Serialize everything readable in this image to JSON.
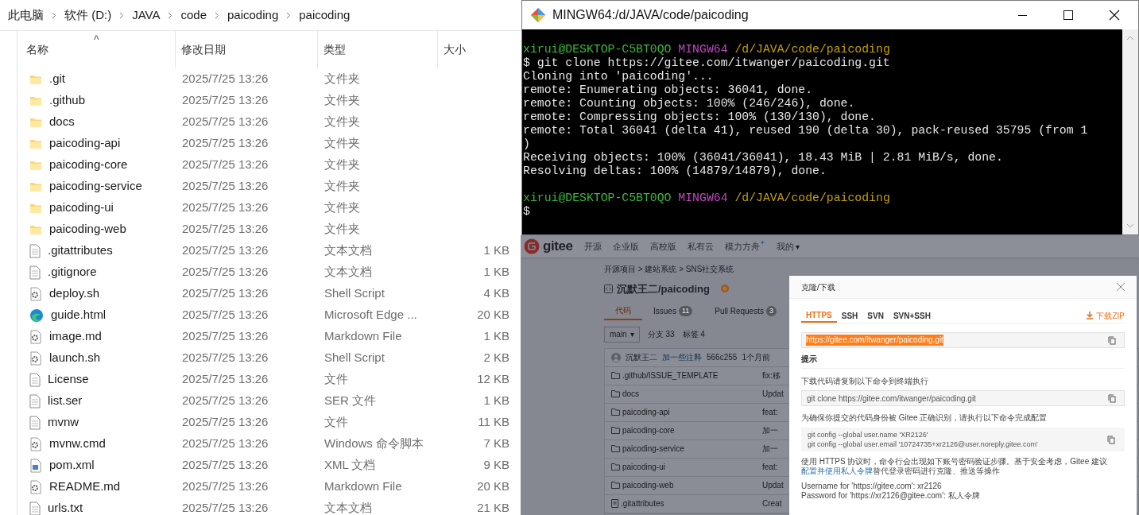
{
  "explorer": {
    "breadcrumb": [
      "此电脑",
      "软件 (D:)",
      "JAVA",
      "code",
      "paicoding",
      "paicoding"
    ],
    "sort_indicator": "^",
    "columns": [
      "名称",
      "修改日期",
      "类型",
      "大小"
    ],
    "rows": [
      {
        "name": ".git",
        "date": "2025/7/25 13:26",
        "type": "文件夹",
        "kind": "folder"
      },
      {
        "name": ".github",
        "date": "2025/7/25 13:26",
        "type": "文件夹",
        "kind": "folder"
      },
      {
        "name": "docs",
        "date": "2025/7/25 13:26",
        "type": "文件夹",
        "kind": "folder"
      },
      {
        "name": "paicoding-api",
        "date": "2025/7/25 13:26",
        "type": "文件夹",
        "kind": "folder"
      },
      {
        "name": "paicoding-core",
        "date": "2025/7/25 13:26",
        "type": "文件夹",
        "kind": "folder"
      },
      {
        "name": "paicoding-service",
        "date": "2025/7/25 13:26",
        "type": "文件夹",
        "kind": "folder"
      },
      {
        "name": "paicoding-ui",
        "date": "2025/7/25 13:26",
        "type": "文件夹",
        "kind": "folder"
      },
      {
        "name": "paicoding-web",
        "date": "2025/7/25 13:26",
        "type": "文件夹",
        "kind": "folder"
      },
      {
        "name": ".gitattributes",
        "date": "2025/7/25 13:26",
        "type": "文本文档",
        "size": "1 KB",
        "kind": "file"
      },
      {
        "name": ".gitignore",
        "date": "2025/7/25 13:26",
        "type": "文本文档",
        "size": "1 KB",
        "kind": "file"
      },
      {
        "name": "deploy.sh",
        "date": "2025/7/25 13:26",
        "type": "Shell Script",
        "size": "4 KB",
        "kind": "script"
      },
      {
        "name": "guide.html",
        "date": "2025/7/25 13:26",
        "type": "Microsoft Edge ...",
        "size": "20 KB",
        "kind": "edge"
      },
      {
        "name": "image.md",
        "date": "2025/7/25 13:26",
        "type": "Markdown File",
        "size": "1 KB",
        "kind": "script"
      },
      {
        "name": "launch.sh",
        "date": "2025/7/25 13:26",
        "type": "Shell Script",
        "size": "2 KB",
        "kind": "script"
      },
      {
        "name": "License",
        "date": "2025/7/25 13:26",
        "type": "文件",
        "size": "12 KB",
        "kind": "file"
      },
      {
        "name": "list.ser",
        "date": "2025/7/25 13:26",
        "type": "SER 文件",
        "size": "1 KB",
        "kind": "file"
      },
      {
        "name": "mvnw",
        "date": "2025/7/25 13:26",
        "type": "文件",
        "size": "11 KB",
        "kind": "file"
      },
      {
        "name": "mvnw.cmd",
        "date": "2025/7/25 13:26",
        "type": "Windows 命令脚本",
        "size": "7 KB",
        "kind": "script"
      },
      {
        "name": "pom.xml",
        "date": "2025/7/25 13:26",
        "type": "XML 文档",
        "size": "9 KB",
        "kind": "xml"
      },
      {
        "name": "README.md",
        "date": "2025/7/25 13:26",
        "type": "Markdown File",
        "size": "20 KB",
        "kind": "script"
      },
      {
        "name": "urls.txt",
        "date": "2025/7/25 13:26",
        "type": "文本文档",
        "size": "21 KB",
        "kind": "file"
      }
    ]
  },
  "terminal": {
    "title": "MINGW64:/d/JAVA/code/paicoding",
    "lines": [
      [
        {
          "text": "xirui@DESKTOP-C5BT0QO",
          "kind": "user"
        },
        {
          "text": " MINGW64",
          "kind": "host"
        },
        {
          "text": " /d/JAVA/code/paicoding",
          "kind": "path"
        }
      ],
      [
        {
          "text": "$ git clone https://gitee.com/itwanger/paicoding.git"
        }
      ],
      [
        {
          "text": "Cloning into 'paicoding'..."
        }
      ],
      [
        {
          "text": "remote: Enumerating objects: 36041, done."
        }
      ],
      [
        {
          "text": "remote: Counting objects: 100% (246/246), done."
        }
      ],
      [
        {
          "text": "remote: Compressing objects: 100% (130/130), done."
        }
      ],
      [
        {
          "text": "remote: Total 36041 (delta 41), reused 190 (delta 30), pack-reused 35795 (from 1"
        }
      ],
      [
        {
          "text": ")"
        }
      ],
      [
        {
          "text": "Receiving objects: 100% (36041/36041), 18.43 MiB | 2.81 MiB/s, done."
        }
      ],
      [
        {
          "text": "Resolving deltas: 100% (14879/14879), done."
        }
      ],
      [
        {
          "text": "xirui@DESKTOP-C5BT0QO",
          "kind": "user",
          "blank_before": true
        },
        {
          "text": " MINGW64",
          "kind": "host"
        },
        {
          "text": " /d/JAVA/code/paicoding",
          "kind": "path"
        }
      ],
      [
        {
          "text": "$"
        }
      ]
    ]
  },
  "gitee": {
    "logo": "gitee",
    "nav": [
      {
        "label": "开源"
      },
      {
        "label": "企业版"
      },
      {
        "label": "高校版"
      },
      {
        "label": "私有云"
      },
      {
        "label": "模力方舟",
        "badge": "✦"
      },
      {
        "label": "我的",
        "caret": "▾"
      }
    ],
    "breadcrumb": "开源项目 > 建站系统 > SNS社交系统",
    "repo": "沉默王二/paicoding",
    "repo_tabs": [
      {
        "label": "代码",
        "selected": true
      },
      {
        "label": "Issues",
        "count": "11",
        "selected": false
      },
      {
        "label": "Pull Requests",
        "count": "3",
        "selected": false
      }
    ],
    "branch": "main",
    "branch_caret": "▾",
    "branches": "分支 33",
    "tags": "标签 4",
    "commit": {
      "author": "沉默王二",
      "message": "加一些注释",
      "hash": "566c255",
      "time": "1个月前"
    },
    "files": [
      {
        "name": ".github/ISSUE_TEMPLATE",
        "message": "fix:移",
        "kind": "folder"
      },
      {
        "name": "docs",
        "message": "Updat",
        "kind": "folder"
      },
      {
        "name": "paicoding-api",
        "message": "feat:",
        "kind": "folder"
      },
      {
        "name": "paicoding-core",
        "message": "加一",
        "kind": "folder"
      },
      {
        "name": "paicoding-service",
        "message": "加一",
        "kind": "folder"
      },
      {
        "name": "paicoding-ui",
        "message": "feat:",
        "kind": "folder"
      },
      {
        "name": "paicoding-web",
        "message": "Updat",
        "kind": "folder"
      },
      {
        "name": ".gitattributes",
        "message": "Creat",
        "kind": "file"
      }
    ],
    "dialog": {
      "title": "克隆/下载",
      "tabs": [
        {
          "label": "HTTPS",
          "selected": true
        },
        {
          "label": "SSH",
          "selected": false
        },
        {
          "label": "SVN",
          "selected": false
        },
        {
          "label": "SVN+SSH",
          "selected": false
        }
      ],
      "download": "下载ZIP",
      "url": "https://gitee.com/itwanger/paicoding.git",
      "hint_title": "提示",
      "clone_hint": "下载代码请复制以下命令到终端执行",
      "clone_command": "git clone https://gitee.com/itwanger/paicoding.git",
      "config_hint": "为确保你提交的代码身份被 Gitee 正确识别，请执行以下命令完成配置",
      "config_lines": [
        "git config --global user.name 'XR2126'",
        "git config --global user.email '10724735+xr2126@user.noreply.gitee.com'"
      ],
      "https_note": "使用 HTTPS 协议时，命令行会出现如下账号密码验证步骤。基于安全考虑，Gitee 建议",
      "token_link": "配置并使用私人令牌",
      "https_note_end": "替代登录密码进行克隆、推送等操作",
      "username_line": "Username for 'https://gitee.com': xr2126",
      "password_line": "Password for 'https://xr2126@gitee.com': 私人令牌"
    }
  }
}
